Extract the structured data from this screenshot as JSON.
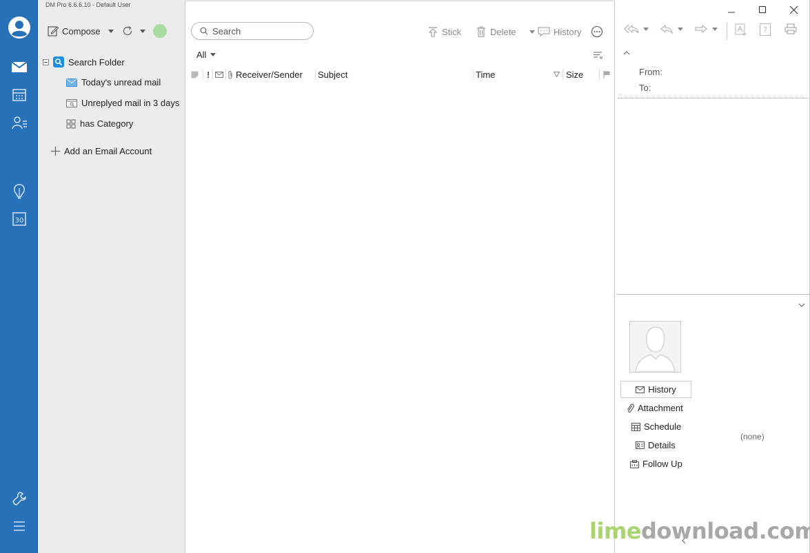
{
  "app": {
    "title": "DM Pro 6.6.6.10  -  Default User"
  },
  "rail": {
    "items": [
      "avatar-icon",
      "mail-icon",
      "calendar-icon",
      "contacts-icon",
      "notes-icon",
      "schedule-30-icon",
      "tools-icon",
      "menu-icon"
    ]
  },
  "folders": {
    "compose_label": "Compose",
    "tree": {
      "root_label": "Search Folder",
      "items": [
        {
          "label": "Today's unread mail",
          "icon": "unread-mail-icon"
        },
        {
          "label": "Unreplyed mail in 3 days",
          "icon": "unreplied-mail-icon"
        },
        {
          "label": "has Category",
          "icon": "category-grid-icon"
        }
      ]
    },
    "add_account_label": "Add an Email Account"
  },
  "list": {
    "search_placeholder": "Search",
    "toolbar": {
      "stick_label": "Stick",
      "delete_label": "Delete",
      "history_label": "History"
    },
    "filter_label": "All",
    "columns": {
      "priority": "!",
      "receiver_sender": "Receiver/Sender",
      "subject": "Subject",
      "time": "Time",
      "size": "Size"
    }
  },
  "reading": {
    "from_label": "From:",
    "to_label": "To:",
    "side_tabs": {
      "history": "History",
      "attachment": "Attachment",
      "schedule": "Schedule",
      "details": "Details",
      "follow_up": "Follow Up"
    },
    "none_label": "(none)"
  },
  "watermark": {
    "part1": "lime",
    "part2": "download.com"
  },
  "colors": {
    "rail": "#2771b8",
    "folder_pane": "#ececec",
    "sync_dot": "#a9dca0",
    "search_folder_icon": "#1e90e0"
  }
}
